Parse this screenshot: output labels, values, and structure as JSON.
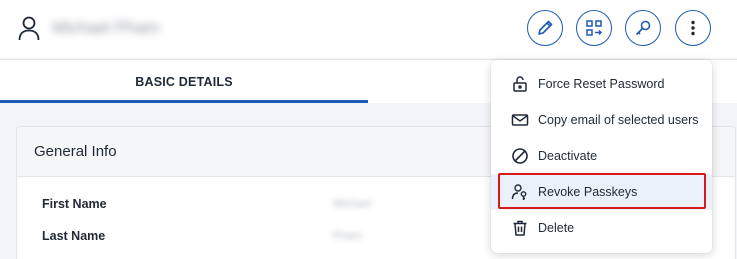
{
  "header": {
    "user_name": "Michael Pham",
    "actions": [
      {
        "icon": "pencil-icon"
      },
      {
        "icon": "qr-transfer-icon"
      },
      {
        "icon": "key-icon"
      },
      {
        "icon": "more-vertical-icon"
      }
    ],
    "accent_color": "#1e5bb8"
  },
  "tabs": {
    "basic_details": "BASIC DETAILS"
  },
  "general_info": {
    "title": "General Info",
    "fields": [
      {
        "label": "First Name",
        "value": "Michael"
      },
      {
        "label": "Last Name",
        "value": "Pham"
      }
    ]
  },
  "menu": {
    "items": [
      {
        "label": "Force Reset Password",
        "icon": "unlock-icon"
      },
      {
        "label": "Copy email of selected users",
        "icon": "envelope-icon"
      },
      {
        "label": "Deactivate",
        "icon": "block-icon"
      },
      {
        "label": "Revoke Passkeys",
        "icon": "user-key-icon",
        "highlighted": true
      },
      {
        "label": "Delete",
        "icon": "trash-icon"
      }
    ],
    "highlight_color": "#d7191c"
  }
}
